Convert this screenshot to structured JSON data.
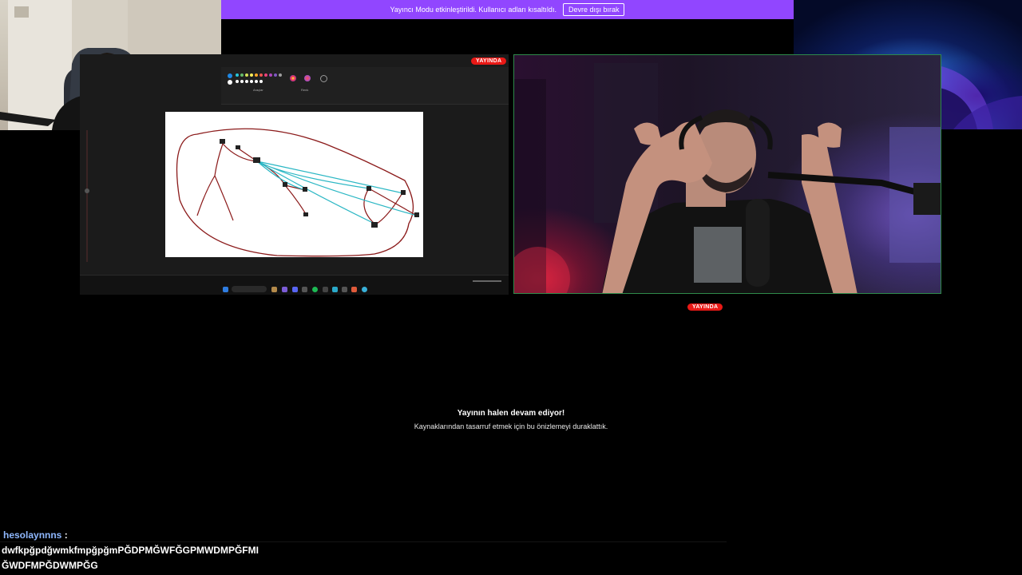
{
  "banner": {
    "message": "Yayıncı Modu etkinleştirildi. Kullanıcı adları kısaltıldı.",
    "disable_button": "Devre dışı bırak",
    "color": "#9146ff"
  },
  "badges": {
    "live_label": "YAYINDA",
    "color": "#e91916"
  },
  "preview_notice": {
    "title": "Yayının halen devam ediyor!",
    "subtitle": "Kaynaklarından tasarruf etmek için bu önizlemeyi duraklattık."
  },
  "chat": {
    "username": "hesolaynnns",
    "separator": ":",
    "message_line_1": "dwfkpğpdğwmkfmpğpğmPĞDPMĞWFĞGPMWDMPĞFMI",
    "message_line_2": "ĞWDFMPĞDWMPĞG",
    "username_color": "#8fb8ff"
  },
  "screen_share": {
    "toolbar_labels": [
      "Araçlar",
      "Renk"
    ],
    "palette": [
      "#1e88e5",
      "#26c6da",
      "#66bb6a",
      "#d4e157",
      "#ffee58",
      "#ffa726",
      "#ef5350",
      "#ec407a",
      "#ab47bc",
      "#7e57c2",
      "#ffffff",
      "#9e9e9e"
    ],
    "drawing_colors": {
      "outline": "#8b1a1a",
      "lines": "#2bb7c4"
    }
  },
  "webcam": {
    "border_color": "#2e8a4a"
  }
}
